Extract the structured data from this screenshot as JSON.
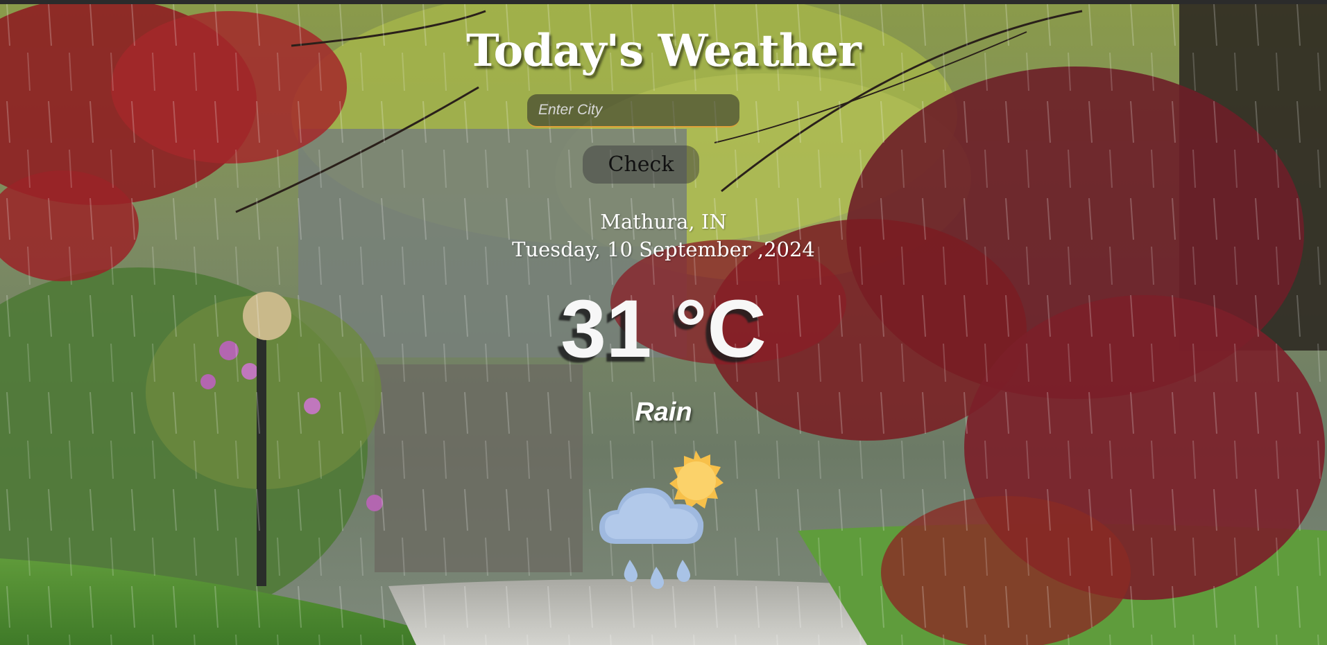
{
  "app": {
    "title": "Today's Weather"
  },
  "search": {
    "placeholder": "Enter City",
    "value": ""
  },
  "actions": {
    "check_label": "Check"
  },
  "weather": {
    "location": "Mathura, IN",
    "date": "Tuesday, 10 September ,2024",
    "temperature": "31 °C",
    "condition": "Rain",
    "icon": "sun-cloud-rain-icon"
  },
  "colors": {
    "text": "#ffffff",
    "input_accent": "#e0a23a",
    "sun": "#f7c04a",
    "cloud": "#a9c3e6",
    "raindrop": "#a9c3e6"
  }
}
